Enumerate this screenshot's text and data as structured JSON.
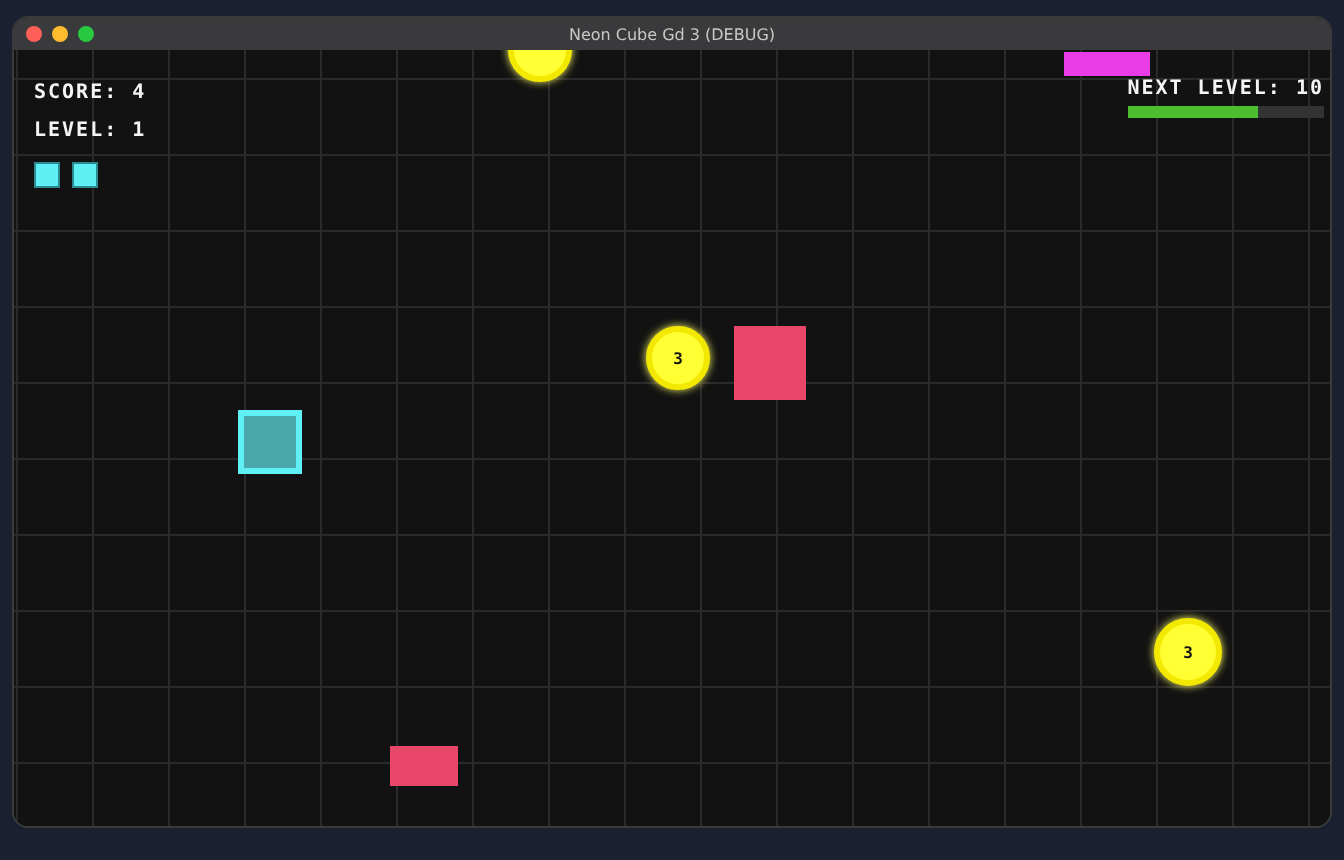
{
  "window": {
    "title": "Neon Cube Gd 3 (DEBUG)"
  },
  "hud": {
    "score": "SCORE: 4",
    "level": "LEVEL: 1",
    "lives": [
      {
        "kind": "life"
      },
      {
        "kind": "life"
      }
    ],
    "next_level": {
      "label": "NEXT LEVEL: 10",
      "level": 0.67
    }
  },
  "objects": [
    {
      "kind": "coin"
    },
    {
      "kind": "pickup"
    },
    {
      "kind": "coin",
      "label": "3"
    },
    {
      "kind": "enemy"
    },
    {
      "kind": "player"
    },
    {
      "kind": "coin",
      "label": "3"
    },
    {
      "kind": "enemy"
    }
  ]
}
